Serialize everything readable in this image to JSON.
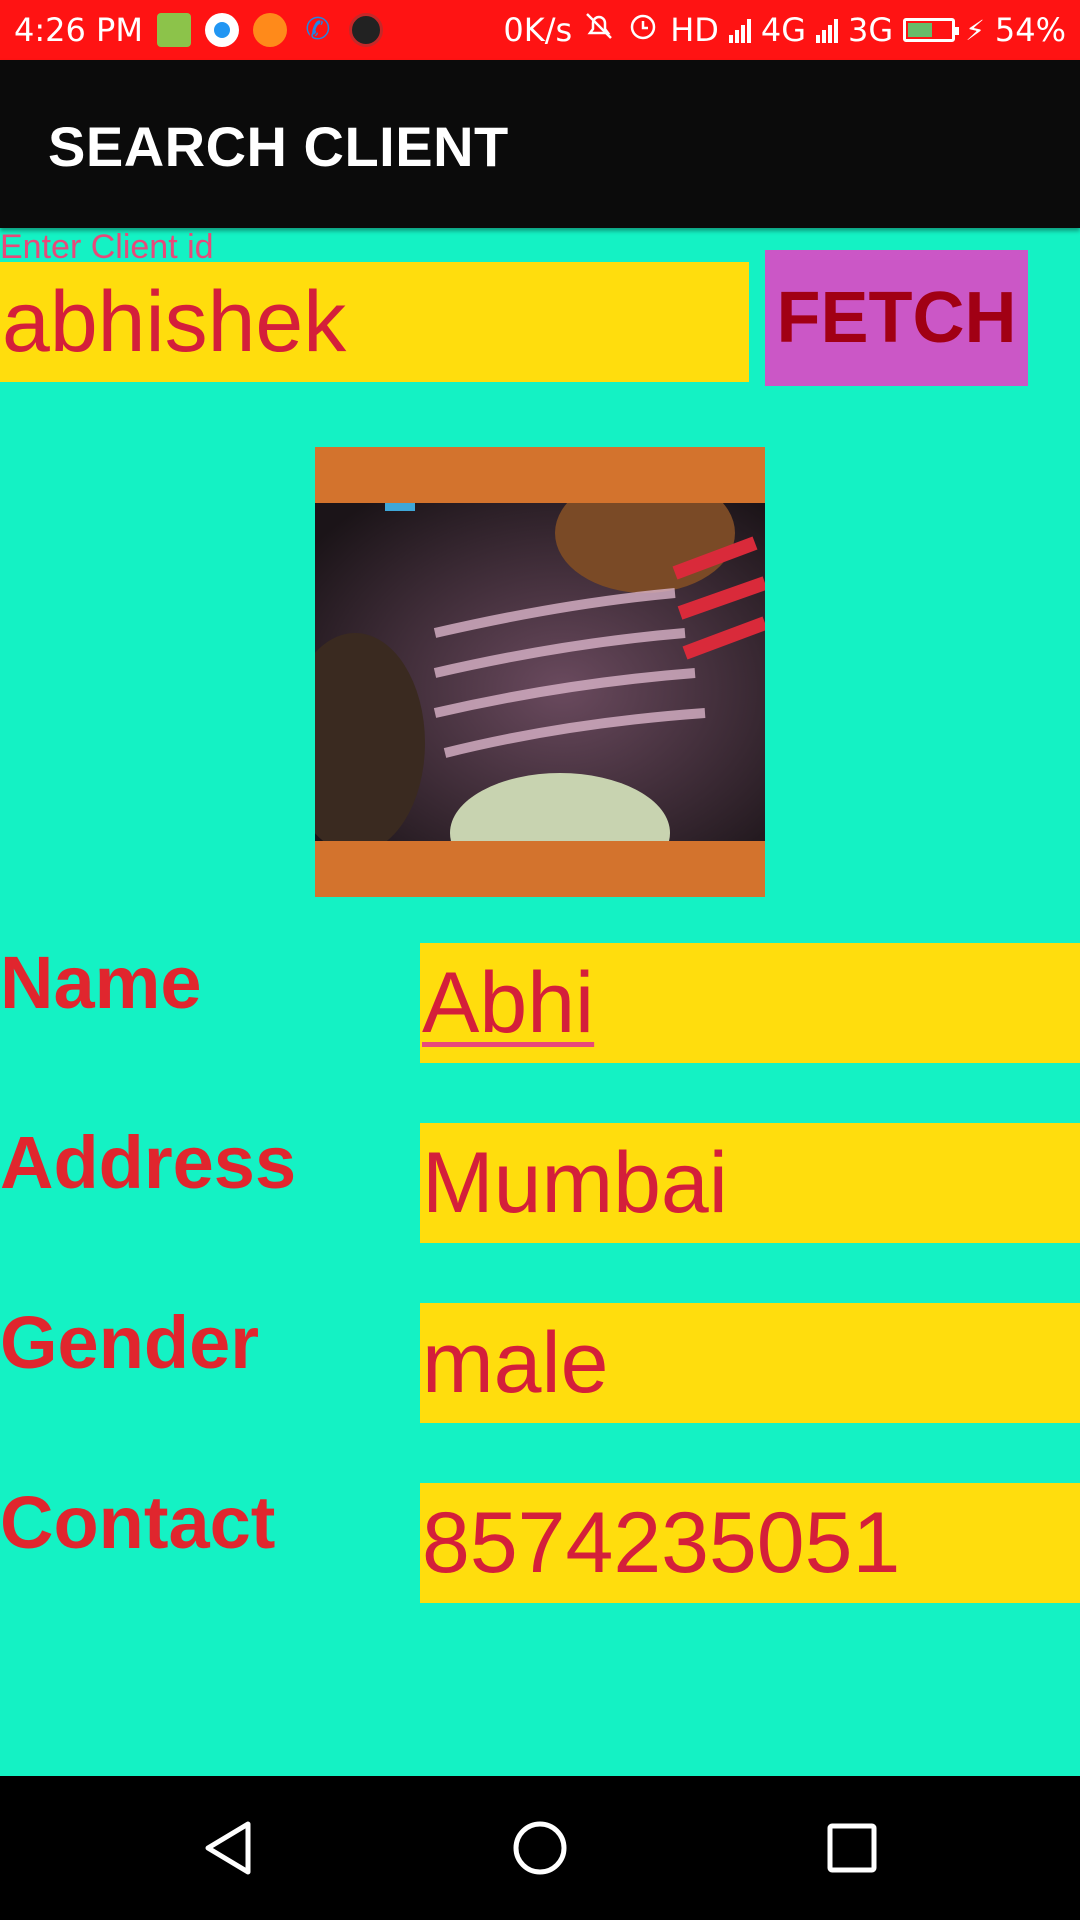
{
  "status_bar": {
    "time": "4:26 PM",
    "network_speed": "0K/s",
    "hd": "HD",
    "network_4g": "4G",
    "network_3g": "3G",
    "battery": "54%",
    "icons": [
      "android-notification-icon",
      "phone-app-icon",
      "crop-icon",
      "call-icon",
      "call-recorder-icon",
      "mute-icon",
      "alarm-icon",
      "signal-icon",
      "battery-icon",
      "charging-icon"
    ]
  },
  "toolbar": {
    "title": "SEARCH CLIENT"
  },
  "search": {
    "label": "Enter Client id",
    "value": "abhishek",
    "button_label": "FETCH"
  },
  "details": {
    "name_label": "Name",
    "name_value": "Abhi",
    "address_label": "Address",
    "address_value": "Mumbai",
    "gender_label": "Gender",
    "gender_value": "male",
    "contact_label": "Contact",
    "contact_value": "8574235051"
  },
  "colors": {
    "status_bar": "#FF1313",
    "toolbar": "#0B0B0B",
    "background": "#14F2C4",
    "field_bg": "#FFDD0D",
    "field_text": "#D41F3A",
    "label_text": "#E0262E",
    "button_bg": "#CB57C6",
    "button_text": "#A10014",
    "photo_frame": "#D3732D"
  }
}
